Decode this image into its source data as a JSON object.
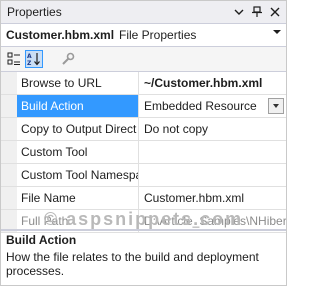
{
  "panel": {
    "title": "Properties",
    "pin_glyph": "⌂",
    "close_glyph": "✕",
    "menu_glyph": "▾"
  },
  "object": {
    "name": "Customer.hbm.xml",
    "type": "File Properties",
    "dropdown_glyph": "▾"
  },
  "toolbar": {
    "icons": [
      "categorized-icon",
      "alphabetical-icon",
      "property-pages-icon"
    ]
  },
  "properties": [
    {
      "name": "Browse to URL",
      "value": "~/Customer.hbm.xml"
    },
    {
      "name": "Build Action",
      "value": "Embedded Resource"
    },
    {
      "name": "Copy to Output Direct",
      "value": "Do not copy"
    },
    {
      "name": "Custom Tool",
      "value": ""
    },
    {
      "name": "Custom Tool Namespa",
      "value": ""
    },
    {
      "name": "File Name",
      "value": "Customer.hbm.xml"
    },
    {
      "name": "Full Path",
      "value": "D:\\Article_Samples\\NHiber"
    }
  ],
  "selected_row_index": 1,
  "watermark": "© aspsnippets.com",
  "description": {
    "title": "Build Action",
    "text": "How the file relates to the build and deployment processes."
  },
  "colors": {
    "selection": "#3399ff",
    "titlebar": "#eeeef2"
  }
}
